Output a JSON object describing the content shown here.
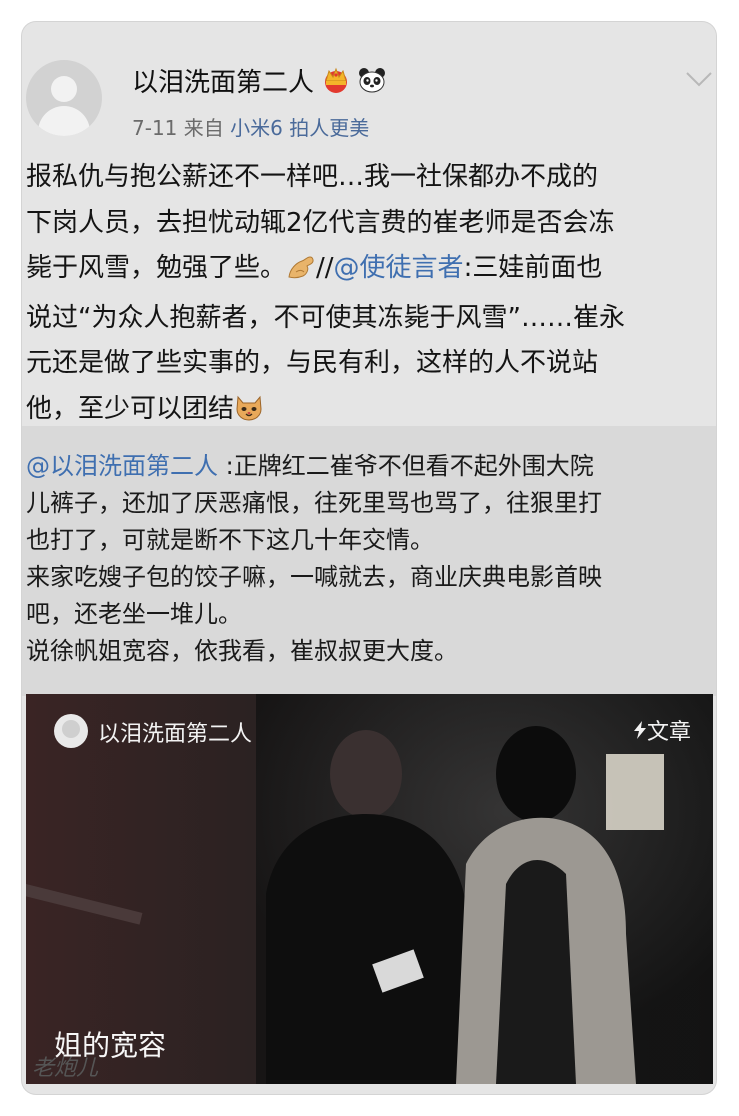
{
  "author": {
    "name": "以泪洗面第二人",
    "date": "7-11",
    "source_prefix": "来自",
    "source_device": "小米6 拍人更美"
  },
  "post": {
    "part1": "报私仇与抱公薪还不一样吧…我一社保都办不成的\n下岗人员，去担忧动辄2亿代言费的崔老师是否会冻\n毙于风雪，勉强了些。",
    "separator": "//",
    "mention": "@使徒言者",
    "part2": ":三娃前面也\n说过“为众人抱薪者，不可使其冻毙于风雪”……崔永\n元还是做了些实事的，与民有利，这样的人不说站\n他，至少可以团结"
  },
  "repost": {
    "mention": "@以泪洗面第二人",
    "text": " :正牌红二崔爷不但看不起外围大院\n儿裤子，还加了厌恶痛恨，往死里骂也骂了，往狠里打\n也打了，可就是断不下这几十年交情。\n来家吃嫂子包的饺子嘛，一喊就去，商业庆典电影首映\n吧，还老坐一堆儿。\n说徐帆姐宽容，依我看，崔叔叔更大度。"
  },
  "media": {
    "author": "以泪洗面第二人",
    "type_label": "文章",
    "caption": "姐的宽容",
    "watermark": "老炮儿"
  },
  "icons": {
    "crown": "crown-icon",
    "panda": "panda-icon",
    "chevron": "chevron-down-icon",
    "flex": "flexed-arm-emoji",
    "cat": "cat-face-emoji",
    "lightning": "lightning-icon"
  },
  "colors": {
    "link": "#3f6fb0",
    "card_bg": "#e5e5e5",
    "repost_bg": "#d9d9d9"
  }
}
